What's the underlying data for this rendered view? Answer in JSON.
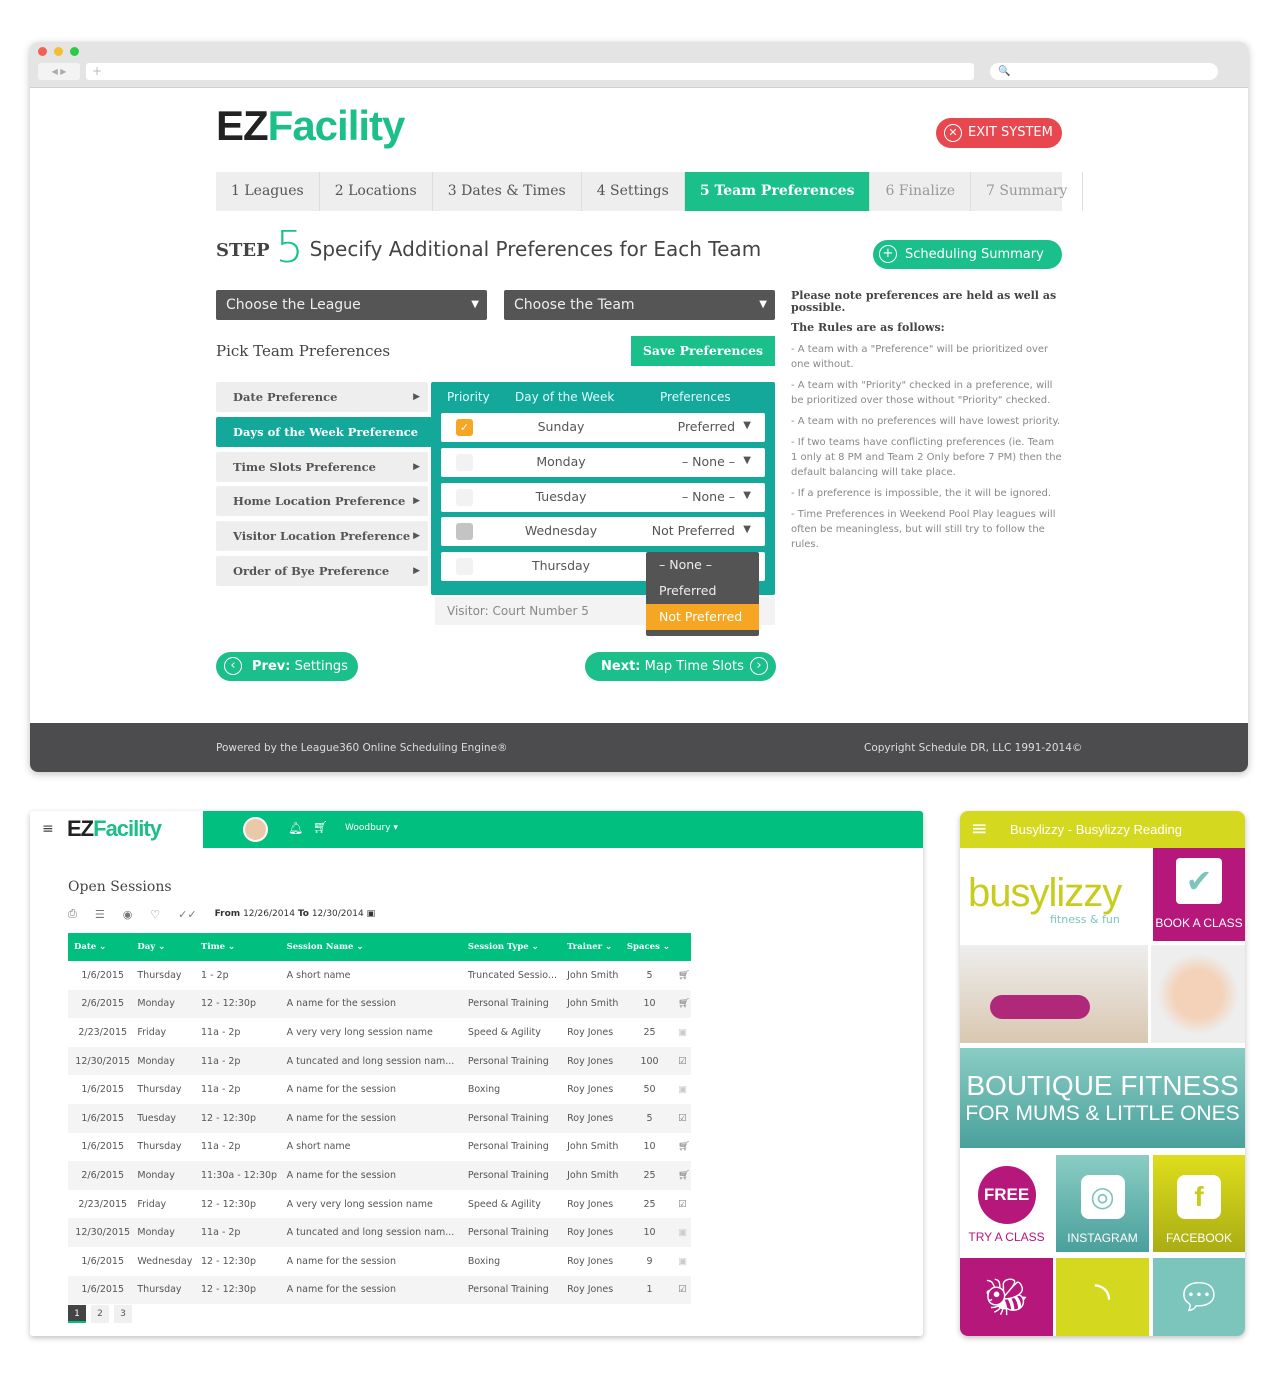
{
  "browser": {
    "url": "+",
    "search": "🔍"
  },
  "app": {
    "logo_ez": "EZ",
    "logo_facility": "Facility",
    "exit_label": "EXIT SYSTEM"
  },
  "steps": [
    "1 Leagues",
    "2 Locations",
    "3 Dates & Times",
    "4 Settings",
    "5 Team Preferences",
    "6 Finalize",
    "7 Summary"
  ],
  "active_step": 4,
  "step": {
    "prefix": "STEP",
    "number": "5",
    "title": "Specify Additional Preferences for Each Team",
    "summary_label": "Scheduling Summary"
  },
  "selects": {
    "league": "Choose the League",
    "team": "Choose the Team"
  },
  "pick": {
    "title": "Pick Team Preferences",
    "save_label": "Save Preferences"
  },
  "pref_items": [
    "Date Preference",
    "Days of the Week Preference",
    "Time Slots Preference",
    "Home Location Preference",
    "Visitor Location Preference",
    "Order of Bye Preference"
  ],
  "grid": {
    "headers": [
      "Priority",
      "Day of the Week",
      "Preferences"
    ],
    "rows": [
      {
        "day": "Sunday",
        "pref": "Preferred",
        "priority": "checked"
      },
      {
        "day": "Monday",
        "pref": "– None –",
        "priority": "unchecked"
      },
      {
        "day": "Tuesday",
        "pref": "– None –",
        "priority": "unchecked"
      },
      {
        "day": "Wednesday",
        "pref": "Not Preferred",
        "priority": "disabled"
      },
      {
        "day": "Thursday",
        "pref": "",
        "priority": "unchecked"
      }
    ],
    "visitor": "Visitor: Court Number 5",
    "dropdown_options": [
      "– None –",
      "Preferred",
      "Not Preferred"
    ],
    "dropdown_highlight": "Not Preferred"
  },
  "nav": {
    "prev_bold": "Prev:",
    "prev": "Settings",
    "next_bold": "Next:",
    "next": "Map Time Slots"
  },
  "rules": {
    "note": "Please note preferences are held as well as possible.",
    "heading": "The Rules are as follows:",
    "items": [
      "- A team with a \"Preference\" will be prioritized over one without.",
      "- A team with \"Priority\" checked in a preference, will be prioritized over those without \"Priority\" checked.",
      "- A team with no preferences will have lowest priority.",
      "- If two teams have conflicting preferences (ie. Team 1 only at 8 PM and Team 2 Only before 7 PM) then the default balancing will take place.",
      "- If a preference is impossible, the it will be ignored.",
      "- Time Preferences in Weekend Pool Play leagues will often be meaningless, but will still try to follow the rules."
    ]
  },
  "footer": {
    "left": "Powered by the League360 Online Scheduling Engine®",
    "right": "Copyright Schedule DR, LLC 1991-2014©"
  },
  "sessions": {
    "location": "Woodbury",
    "title": "Open Sessions",
    "from_label": "From",
    "from": "12/26/2014",
    "to_label": "To",
    "to": "12/30/2014",
    "columns": [
      "Date",
      "Day",
      "Time",
      "Session Name",
      "Session Type",
      "Trainer",
      "Spaces"
    ],
    "rows": [
      [
        "1/6/2015",
        "Thursday",
        "1 - 2p",
        "A short name",
        "Truncated Sessio...",
        "John Smith",
        "5",
        "cart"
      ],
      [
        "2/6/2015",
        "Monday",
        "12 - 12:30p",
        "A name for the session",
        "Personal Training",
        "John Smith",
        "10",
        "cart"
      ],
      [
        "2/23/2015",
        "Friday",
        "11a - 2p",
        "A very very long session name",
        "Speed & Agility",
        "Roy Jones",
        "25",
        "person"
      ],
      [
        "12/30/2015",
        "Monday",
        "11a - 2p",
        "A tuncated and long session nam...",
        "Personal Training",
        "Roy Jones",
        "100",
        "calendar"
      ],
      [
        "1/6/2015",
        "Thursday",
        "11a - 2p",
        "A name for the session",
        "Boxing",
        "Roy Jones",
        "50",
        "person"
      ],
      [
        "1/6/2015",
        "Tuesday",
        "12 - 12:30p",
        "A name for the session",
        "Personal Training",
        "Roy Jones",
        "5",
        "calendar"
      ],
      [
        "1/6/2015",
        "Thursday",
        "11a - 2p",
        "A short name",
        "Personal Training",
        "John Smith",
        "10",
        "cart"
      ],
      [
        "2/6/2015",
        "Monday",
        "11:30a - 12:30p",
        "A name for the session",
        "Personal Training",
        "John Smith",
        "25",
        "cart"
      ],
      [
        "2/23/2015",
        "Friday",
        "12 - 12:30p",
        "A very very long session name",
        "Speed & Agility",
        "Roy Jones",
        "25",
        "calendar"
      ],
      [
        "12/30/2015",
        "Monday",
        "11a - 2p",
        "A tuncated and long session nam...",
        "Personal Training",
        "Roy Jones",
        "10",
        "person"
      ],
      [
        "1/6/2015",
        "Wednesday",
        "12 - 12:30p",
        "A name for the session",
        "Boxing",
        "Roy Jones",
        "9",
        "person"
      ],
      [
        "1/6/2015",
        "Thursday",
        "12 - 12:30p",
        "A name for the session",
        "Personal Training",
        "Roy Jones",
        "1",
        "calendar"
      ]
    ],
    "pages": [
      "1",
      "2",
      "3"
    ],
    "current_page": "1"
  },
  "busylizzy": {
    "title": "Busylizzy - Busylizzy Reading",
    "logo": "busylizzy",
    "tagline": "fitness & fun",
    "book": "BOOK A CLASS",
    "banner1": "BOUTIQUE FITNESS",
    "banner2": "FOR MUMS & LITTLE ONES",
    "free": "FREE",
    "try": "TRY A CLASS",
    "instagram": "INSTAGRAM",
    "facebook": "FACEBOOK"
  },
  "colors": {
    "green": "#1abf8a",
    "teal": "#14a89a",
    "red": "#e8474f",
    "orange": "#f6a623",
    "lime": "#d4d81e",
    "magenta": "#b5177a",
    "bl_teal": "#7cc5bd"
  }
}
